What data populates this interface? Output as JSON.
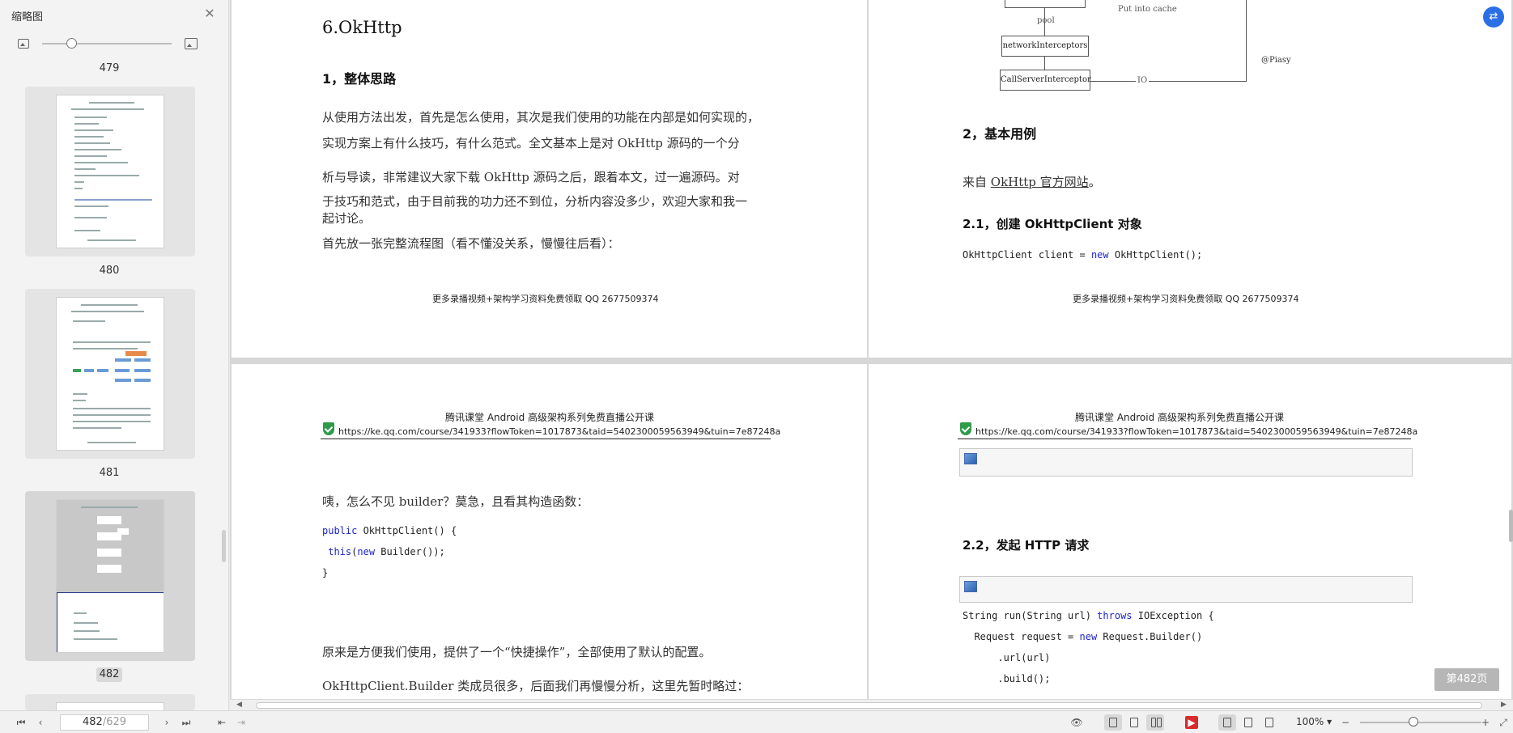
{
  "sidebar": {
    "title": "缩略图",
    "page_numbers": [
      "479",
      "480",
      "481",
      "482"
    ],
    "zoom_level": 0.2
  },
  "page1": {
    "heading": "6.OkHttp",
    "section": "1，整体思路",
    "paragraph_lines": [
      "从使用方法出发，首先是怎么使用，其次是我们使用的功能在内部是如何实现的，",
      "实现方案上有什么技巧，有什么范式。全文基本上是对 OkHttp 源码的一个分",
      "析与导读，非常建议大家下载 OkHttp 源码之后，跟着本文，过一遍源码。对",
      "于技巧和范式，由于目前我的功力还不到位，分析内容没多少，欢迎大家和我一",
      "起讨论。"
    ],
    "intro": "首先放一张完整流程图（看不懂没关系，慢慢往后看）：",
    "footer": "更多录播视频+架构学习资料免费领取 QQ 2677509374"
  },
  "page2": {
    "diagram": {
      "pool_label": "pool",
      "cache_label": "Put into cache",
      "box1": "networkInterceptors",
      "box2": "CallServerInterceptor",
      "io_label": "IO",
      "credit": "@Piasy"
    },
    "section": "2，基本用例",
    "source_prefix": "来自 ",
    "source_link": "OkHttp 官方网站",
    "source_suffix": "。",
    "subsection": "2.1，创建 OkHttpClient 对象",
    "code_prefix": "OkHttpClient client = ",
    "code_kw": "new",
    "code_suffix": " OkHttpClient();",
    "footer": "更多录播视频+架构学习资料免费领取 QQ 2677509374"
  },
  "page3": {
    "header_title": "腾讯课堂 Android 高级架构系列免费直播公开课",
    "header_url": "https://ke.qq.com/course/341933?flowToken=1017873&taid=5402300059563949&tuin=7e87248a",
    "question": "咦，怎么不见 builder？莫急，且看其构造函数：",
    "code_l1_kw": "public",
    "code_l1": " OkHttpClient() {",
    "code_l2_kw": "this",
    "code_l2_mid": "(",
    "code_l2_kw2": "new",
    "code_l2_end": " Builder());",
    "code_l3": "}",
    "para1": "原来是方便我们使用，提供了一个“快捷操作”，全部使用了默认的配置。",
    "para2": "OkHttpClient.Builder 类成员很多，后面我们再慢慢分析，这里先暂时略过："
  },
  "page4": {
    "header_title": "腾讯课堂 Android 高级架构系列免费直播公开课",
    "header_url": "https://ke.qq.com/course/341933?flowToken=1017873&taid=5402300059563949&tuin=7e87248a",
    "subsection": "2.2，发起 HTTP 请求",
    "code_l1": "String run(String url) ",
    "code_l1_kw": "throws",
    "code_l1_end": " IOException {",
    "code_l2": "  Request request = ",
    "code_l2_kw": "new",
    "code_l2_end": " Request.Builder()",
    "code_l3": "      .url(url)",
    "code_l4": "      .build();"
  },
  "status": {
    "current_page": "482",
    "total_pages": "/629",
    "zoom": "100%",
    "page_badge": "第482页"
  }
}
